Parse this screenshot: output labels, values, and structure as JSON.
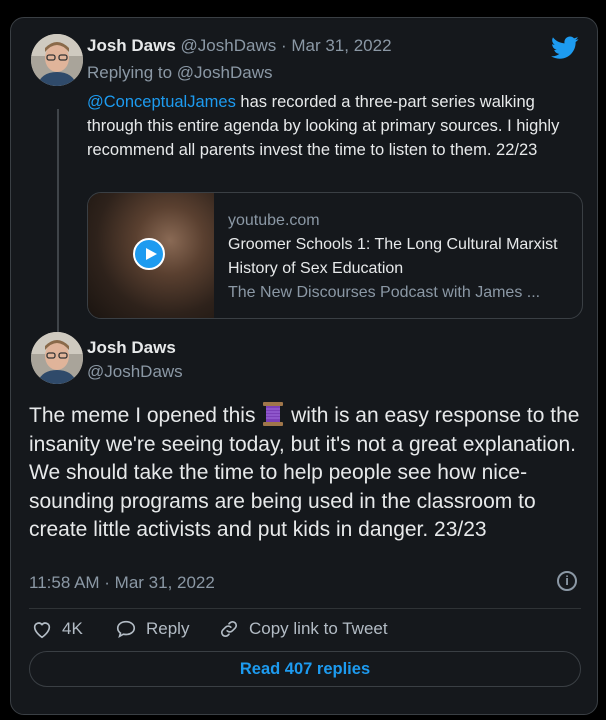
{
  "reply_tweet": {
    "author_name": "Josh Daws",
    "author_handle": "@JoshDaws",
    "date": "· Mar 31, 2022",
    "replying_to_prefix": "Replying to",
    "replying_to_handle": "@JoshDaws",
    "mention": "@ConceptualJames",
    "body": " has recorded a three-part series walking through this entire agenda by looking at primary sources. I highly recommend all parents invest the time to listen to them. 22/23",
    "link_card": {
      "domain": "youtube.com",
      "title": "Groomer Schools 1: The Long Cultural Marxist History of Sex Education",
      "description": "The New Discourses Podcast with James ..."
    }
  },
  "main_tweet": {
    "author_name": "Josh Daws",
    "author_handle": "@JoshDaws",
    "body_before_emoji": "The meme I opened this ",
    "emoji_icon": "thread-spool-icon",
    "body_after_emoji": " with is an easy response to the insanity we're seeing today, but it's not a great explanation. We should take the time to help people see how nice-sounding programs are being used in the classroom to create little activists and put kids in danger. 23/23",
    "timestamp": "11:58 AM · Mar 31, 2022"
  },
  "actions": {
    "like_count": "4K",
    "reply_label": "Reply",
    "copy_link_label": "Copy link to Tweet"
  },
  "read_replies_label": "Read 407 replies",
  "colors": {
    "accent": "#1d9bf0",
    "background": "#15181c",
    "muted": "#8b98a5"
  }
}
